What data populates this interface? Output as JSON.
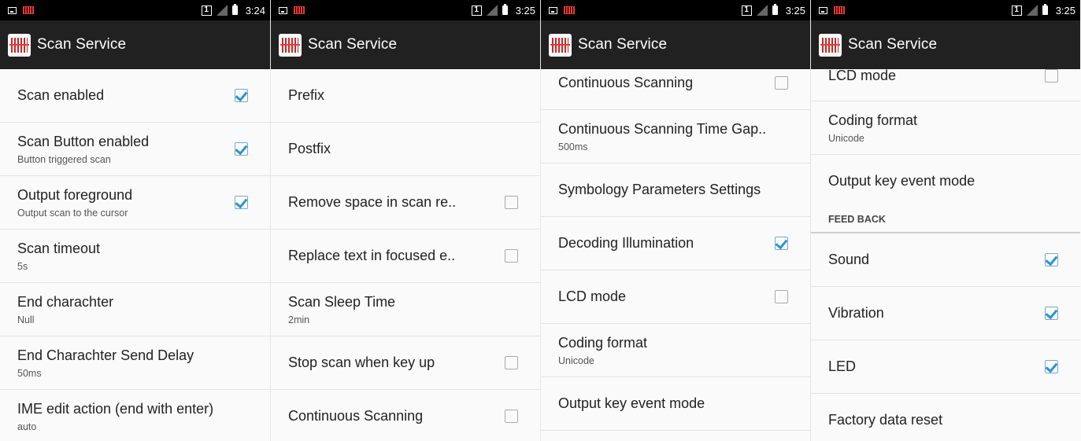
{
  "status_times": [
    "3:24",
    "3:25",
    "3:25",
    "3:25"
  ],
  "sim_label": "1",
  "app_title": "Scan Service",
  "panel1": [
    {
      "title": "Scan enabled",
      "summary": "",
      "checkbox": "checked"
    },
    {
      "title": "Scan Button enabled",
      "summary": "Button triggered scan",
      "checkbox": "checked"
    },
    {
      "title": "Output foreground",
      "summary": "Output scan to the cursor",
      "checkbox": "checked"
    },
    {
      "title": "Scan timeout",
      "summary": "5s",
      "checkbox": "none"
    },
    {
      "title": "End charachter",
      "summary": "Null",
      "checkbox": "none"
    },
    {
      "title": "End Charachter Send Delay",
      "summary": "50ms",
      "checkbox": "none"
    },
    {
      "title": "IME edit action (end with enter)",
      "summary": "auto",
      "checkbox": "none"
    }
  ],
  "panel2": [
    {
      "title": "Prefix",
      "summary": "",
      "checkbox": "none"
    },
    {
      "title": "Postfix",
      "summary": "",
      "checkbox": "none"
    },
    {
      "title": "Remove space in scan re..",
      "summary": "",
      "checkbox": "unchecked"
    },
    {
      "title": "Replace text in focused e..",
      "summary": "",
      "checkbox": "unchecked"
    },
    {
      "title": "Scan Sleep Time",
      "summary": "2min",
      "checkbox": "none"
    },
    {
      "title": "Stop scan when key up",
      "summary": "",
      "checkbox": "unchecked"
    },
    {
      "title": "Continuous Scanning",
      "summary": "",
      "checkbox": "unchecked"
    }
  ],
  "panel3": [
    {
      "title": "Continuous Scanning",
      "summary": "",
      "checkbox": "unchecked"
    },
    {
      "title": "Continuous Scanning Time Gap..",
      "summary": "500ms",
      "checkbox": "none"
    },
    {
      "title": "Symbology Parameters Settings",
      "summary": "",
      "checkbox": "none"
    },
    {
      "title": "Decoding Illumination",
      "summary": "",
      "checkbox": "checked"
    },
    {
      "title": "LCD mode",
      "summary": "",
      "checkbox": "unchecked"
    },
    {
      "title": "Coding format",
      "summary": "Unicode",
      "checkbox": "none"
    },
    {
      "title": "Output key event mode",
      "summary": "",
      "checkbox": "none"
    }
  ],
  "panel4": {
    "top_items": [
      {
        "title": "LCD mode",
        "summary": "",
        "checkbox": "unchecked"
      },
      {
        "title": "Coding format",
        "summary": "Unicode",
        "checkbox": "none"
      },
      {
        "title": "Output key event mode",
        "summary": "",
        "checkbox": "none"
      }
    ],
    "section_header": "FEED BACK",
    "bottom_items": [
      {
        "title": "Sound",
        "summary": "",
        "checkbox": "checked"
      },
      {
        "title": "Vibration",
        "summary": "",
        "checkbox": "checked"
      },
      {
        "title": "LED",
        "summary": "",
        "checkbox": "checked"
      },
      {
        "title": "Factory data reset",
        "summary": "",
        "checkbox": "none"
      }
    ]
  }
}
